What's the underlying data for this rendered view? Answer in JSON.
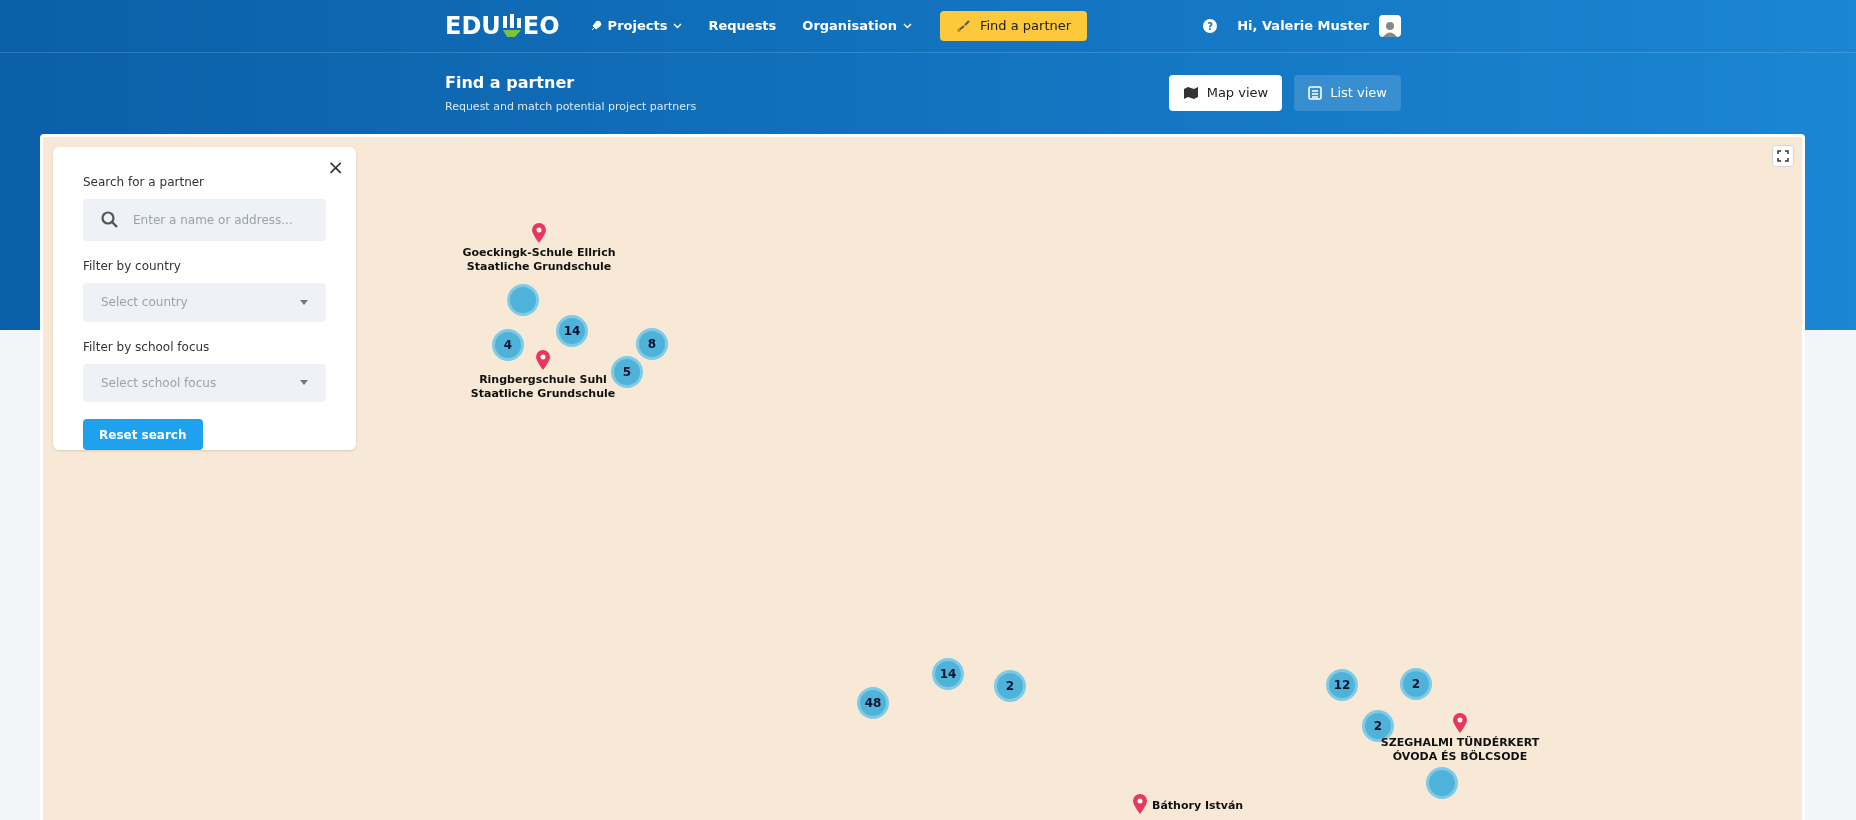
{
  "nav": {
    "logo": "EDU",
    "logo_end": "EO",
    "items": [
      {
        "label": "Projects",
        "dropdown": true
      },
      {
        "label": "Requests",
        "dropdown": false
      },
      {
        "label": "Organisation",
        "dropdown": true
      }
    ],
    "cta": "Find a partner",
    "help": "?",
    "greeting": "Hi, Valerie Muster"
  },
  "page": {
    "title": "Find a partner",
    "subtitle": "Request and match potential project partners",
    "views": [
      {
        "label": "Map view",
        "selected": true
      },
      {
        "label": "List view",
        "selected": false
      }
    ]
  },
  "filter_panel": {
    "close": "×",
    "search_label": "Search for a partner",
    "search_placeholder": "Enter a name or address...",
    "country_label": "Filter by country",
    "country_placeholder": "Select country",
    "focus_label": "Filter by school focus",
    "focus_placeholder": "Select school focus",
    "reset": "Reset search"
  },
  "map_items": [
    {
      "kind": "cluster"
    },
    {
      "kind": "cluster",
      "label": "14"
    },
    {
      "kind": "cluster",
      "label": "4"
    },
    {
      "kind": "cluster",
      "label": "8"
    },
    {
      "kind": "cluster",
      "label": "5"
    },
    {
      "kind": "cluster",
      "label": "14"
    },
    {
      "kind": "cluster",
      "label": "2"
    },
    {
      "kind": "cluster",
      "label": "48"
    },
    {
      "kind": "cluster",
      "label": "12"
    },
    {
      "kind": "cluster",
      "label": "2"
    },
    {
      "kind": "cluster",
      "label": "2"
    },
    {
      "kind": "cluster"
    },
    {
      "kind": "pin",
      "label": "Goeckingk-Schule Ellrich Staatliche Grundschule"
    },
    {
      "kind": "pin",
      "label": "Ringbergschule Suhl Staatliche Grundschule"
    },
    {
      "kind": "pin",
      "label": "SZEGHALMI TÜNDÉRKERT ÓVODA ÉS BÖLCSODE"
    },
    {
      "kind": "pin",
      "label": "Báthory István"
    }
  ]
}
